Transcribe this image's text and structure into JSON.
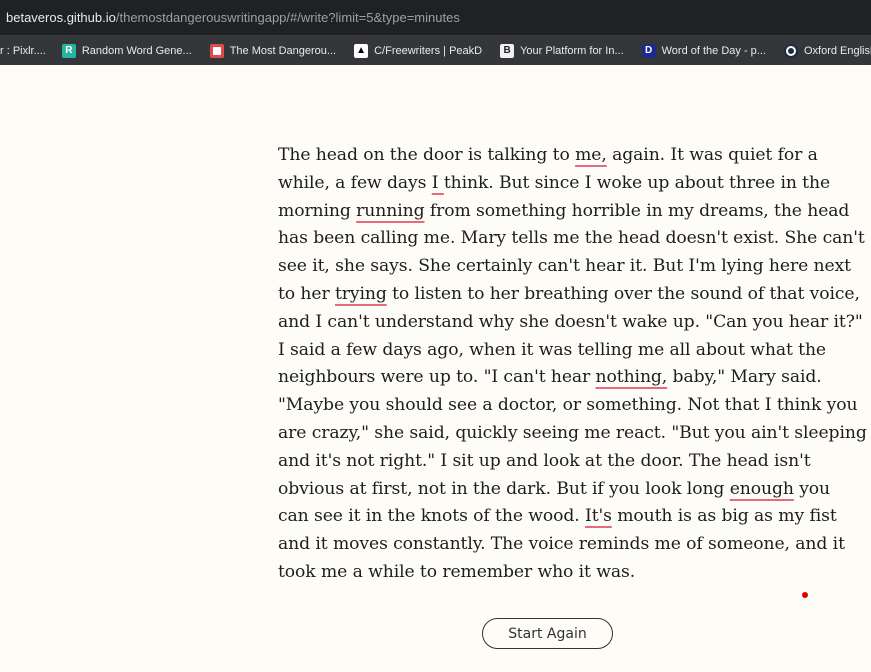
{
  "browser": {
    "url_host": "betaveros.github.io",
    "url_path": "/themostdangerouswritingapp/#/write?limit=5&type=minutes",
    "bookmarks": [
      {
        "label": "r : Pixlr....",
        "icon": "none"
      },
      {
        "label": "Random Word Gene...",
        "icon": "random-word-icon"
      },
      {
        "label": "The Most Dangerou...",
        "icon": "most-dangerous-icon"
      },
      {
        "label": "C/Freewriters | PeakD",
        "icon": "peakd-icon"
      },
      {
        "label": "Your Platform for In...",
        "icon": "platform-icon"
      },
      {
        "label": "Word of the Day - p...",
        "icon": "word-of-day-icon"
      },
      {
        "label": "Oxford English Dicti",
        "icon": "oxford-icon"
      }
    ]
  },
  "story": {
    "lines": [
      [
        "The head on the door is talking to ",
        {
          "sp": "me,"
        },
        " again. It was quiet for a"
      ],
      [
        "while, a few days ",
        {
          "sp": "I "
        },
        "think. But since I woke up about three in the"
      ],
      [
        "morning ",
        {
          "sp": "running"
        },
        " from something horrible in my dreams, the head"
      ],
      [
        "has been calling me. Mary tells me the head doesn't exist. She can't"
      ],
      [
        "see it, she says. She certainly can't hear it. But I'm lying here next"
      ],
      [
        "to her ",
        {
          "sp": "trying"
        },
        " to listen to her breathing over the sound of that voice,"
      ],
      [
        "and I can't understand why she doesn't wake up. \"Can you hear it?\""
      ],
      [
        "I said a few days ago, when it was telling me all about what the"
      ],
      [
        "neighbours were up to. \"I can't hear ",
        {
          "sp": "nothing,"
        },
        " baby,\" Mary said."
      ],
      [
        "\"Maybe you should see a doctor, or something. Not that I think you"
      ],
      [
        "are crazy,\" she said, quickly seeing me react. \"But you ain't sleeping"
      ],
      [
        "and it's not right.\" I sit up and look at the door. The head isn't"
      ],
      [
        "obvious at first, not in the dark. But if you look long ",
        {
          "sp": "enough"
        },
        " you"
      ],
      [
        "can see it in the knots of the wood. ",
        {
          "sp": "It's"
        },
        " mouth is as big as my fist"
      ],
      [
        "and it moves constantly. The voice reminds me of someone, and it"
      ],
      [
        "took me a while to remember who it was."
      ]
    ]
  },
  "actions": {
    "start_again_label": "Start Again"
  },
  "colors": {
    "spellcheck_underline": "#e36b7c",
    "indicator_dot": "#e00000",
    "page_bg": "#fdfcf7"
  }
}
